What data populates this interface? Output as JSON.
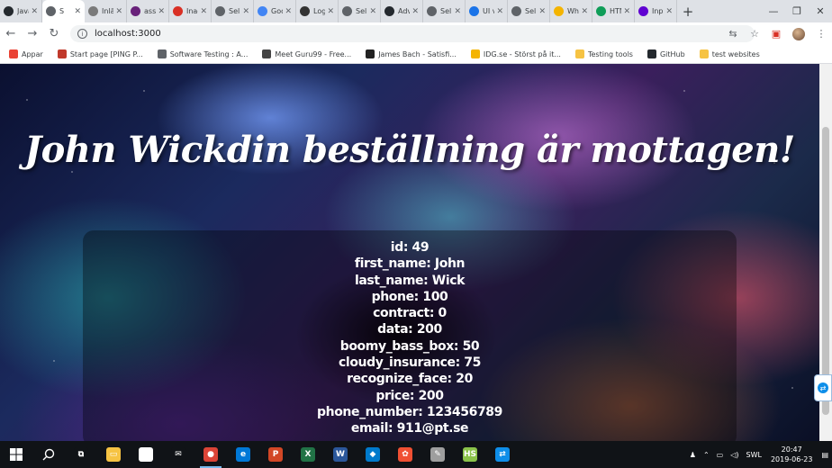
{
  "browser": {
    "tabs": [
      {
        "label": "Javas",
        "icon": "github-icon",
        "color": "#24292e"
      },
      {
        "label": "S",
        "icon": "globe-icon",
        "color": "#5f6368",
        "active": true
      },
      {
        "label": "Inlän",
        "icon": "document-icon",
        "color": "#7a7a7a"
      },
      {
        "label": "assig",
        "icon": "visual-studio-icon",
        "color": "#68217a"
      },
      {
        "label": "Inact",
        "icon": "gmail-icon",
        "color": "#d93025"
      },
      {
        "label": "Selle",
        "icon": "globe-icon",
        "color": "#5f6368"
      },
      {
        "label": "Goog",
        "icon": "docs-icon",
        "color": "#4285f4"
      },
      {
        "label": "Login",
        "icon": "wikipedia-icon",
        "color": "#333333"
      },
      {
        "label": "Selle",
        "icon": "globe-icon",
        "color": "#5f6368"
      },
      {
        "label": "Adva",
        "icon": "github-icon",
        "color": "#24292e"
      },
      {
        "label": "Selle",
        "icon": "globe-icon",
        "color": "#5f6368"
      },
      {
        "label": "UI vs",
        "icon": "shield-icon",
        "color": "#1a73e8"
      },
      {
        "label": "Selle",
        "icon": "globe-icon",
        "color": "#5f6368"
      },
      {
        "label": "Wha",
        "icon": "pen-icon",
        "color": "#f4b400"
      },
      {
        "label": "HTM",
        "icon": "html-icon",
        "color": "#0f9d58"
      },
      {
        "label": "Inpu",
        "icon": "yahoo-icon",
        "color": "#5f01d1"
      }
    ],
    "new_tab": "+",
    "window_controls": {
      "minimize": "—",
      "restore": "❐",
      "close": "✕"
    },
    "url": "localhost:3000",
    "bookmarks": [
      {
        "label": "Appar",
        "icon": "apps-icon",
        "color": "#ea4335"
      },
      {
        "label": "Start page [PING P...",
        "icon": "page-icon",
        "color": "#c0392b"
      },
      {
        "label": "Software Testing : A...",
        "icon": "globe-icon",
        "color": "#5f6368"
      },
      {
        "label": "Meet Guru99 - Free...",
        "icon": "guru-icon",
        "color": "#444444"
      },
      {
        "label": "James Bach - Satisfi...",
        "icon": "star-icon",
        "color": "#222222"
      },
      {
        "label": "IDG.se - Störst på it...",
        "icon": "pen-icon",
        "color": "#f4b400"
      },
      {
        "label": "Testing tools",
        "icon": "folder-icon",
        "color": "#f6c343"
      },
      {
        "label": "GitHub",
        "icon": "github-icon",
        "color": "#24292e"
      },
      {
        "label": "test websites",
        "icon": "folder-icon",
        "color": "#f6c343"
      }
    ]
  },
  "page": {
    "headline": "John Wickdin beställning är mottagen!",
    "order_lines": [
      "id: 49",
      "first_name: John",
      "last_name: Wick",
      "phone: 100",
      "contract: 0",
      "data: 200",
      "boomy_bass_box: 50",
      "cloudy_insurance: 75",
      "recognize_face: 20",
      "price: 200",
      "phone_number: 123456789",
      "email: 911@pt.se"
    ]
  },
  "taskbar": {
    "apps": [
      {
        "name": "task-view",
        "glyph": "⧉",
        "color": "#101317"
      },
      {
        "name": "file-explorer",
        "glyph": "▭",
        "color": "#f6c343"
      },
      {
        "name": "store",
        "glyph": "▦",
        "color": "#ffffff"
      },
      {
        "name": "mail",
        "glyph": "✉",
        "color": "#101317"
      },
      {
        "name": "chrome",
        "glyph": "●",
        "color": "#db4437",
        "active": true
      },
      {
        "name": "edge",
        "glyph": "e",
        "color": "#0078d7"
      },
      {
        "name": "powerpoint",
        "glyph": "P",
        "color": "#d24726"
      },
      {
        "name": "excel",
        "glyph": "X",
        "color": "#217346"
      },
      {
        "name": "word",
        "glyph": "W",
        "color": "#2b579a"
      },
      {
        "name": "vscode",
        "glyph": "◆",
        "color": "#007acc"
      },
      {
        "name": "git-tool",
        "glyph": "✿",
        "color": "#f05033"
      },
      {
        "name": "feather-app",
        "glyph": "✎",
        "color": "#9e9e9e"
      },
      {
        "name": "game-app",
        "glyph": "HS",
        "color": "#8bc34a"
      },
      {
        "name": "teamviewer",
        "glyph": "⇄",
        "color": "#0e8ee9"
      }
    ],
    "language": "SWL",
    "time": "20:47",
    "date": "2019-06-23"
  }
}
